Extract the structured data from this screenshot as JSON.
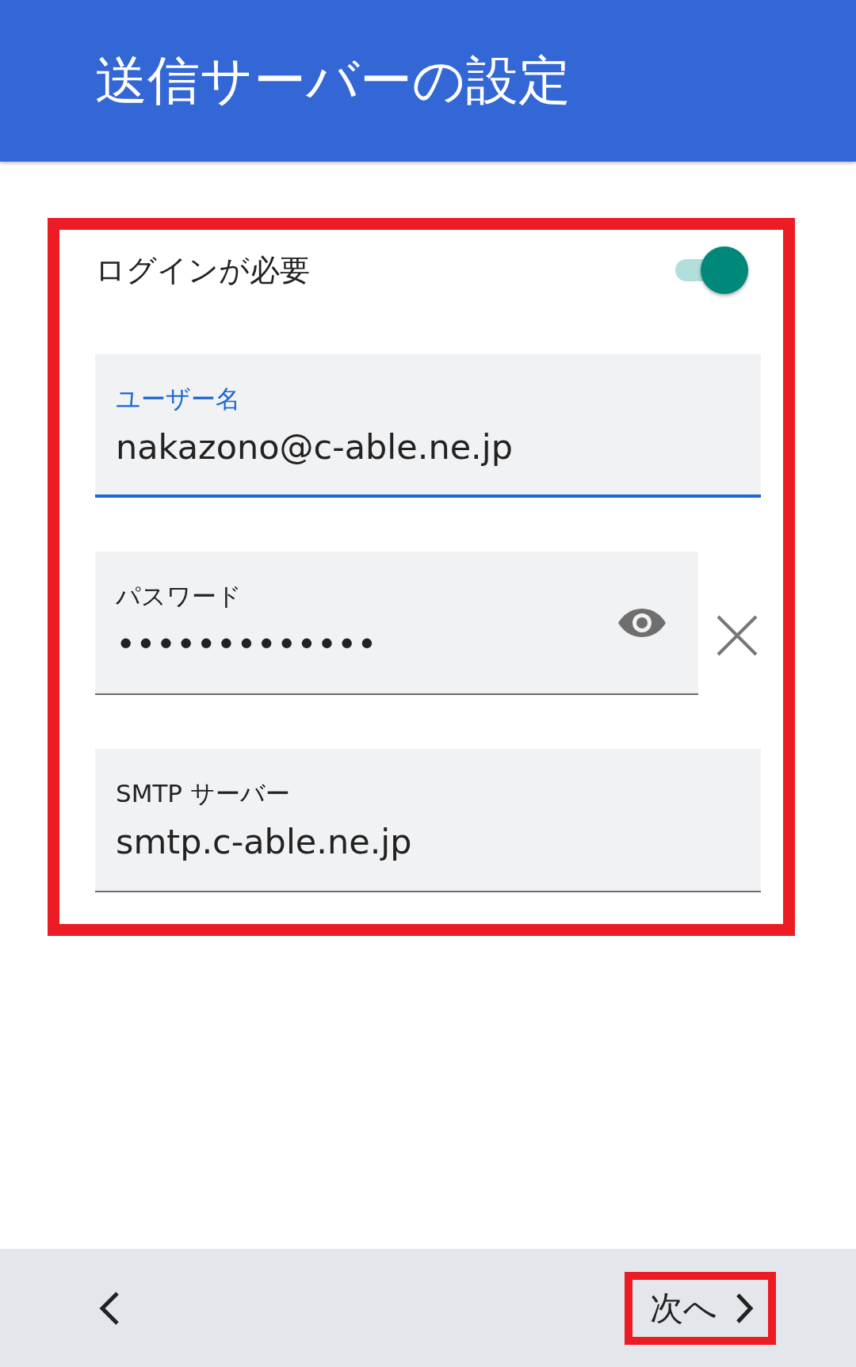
{
  "header": {
    "title": "送信サーバーの設定"
  },
  "form": {
    "highlighted": true,
    "login_required": {
      "label": "ログインが必要",
      "on": true
    },
    "fields": [
      {
        "kind": "text",
        "label": "ユーザー名",
        "value": "nakazono@c-able.ne.jp",
        "focused": true
      },
      {
        "kind": "password",
        "label": "パスワード",
        "value": "•••••••••••••",
        "focused": false
      },
      {
        "kind": "text",
        "label": "SMTP サーバー",
        "value": "smtp.c-able.ne.jp",
        "focused": false
      }
    ]
  },
  "bottom_bar": {
    "next": {
      "label": "次へ",
      "highlighted": true
    }
  }
}
